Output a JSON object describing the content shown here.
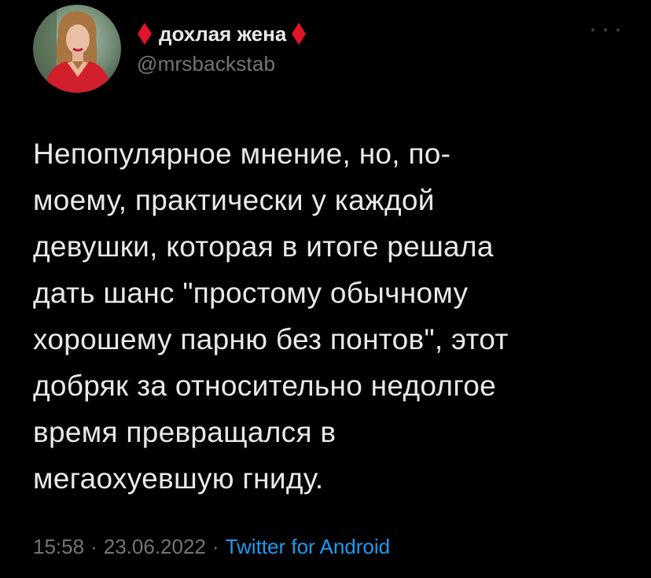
{
  "author": {
    "display_name": "дохлая жена",
    "handle": "@mrsbackstab",
    "avatar_icon": "profile-photo"
  },
  "header": {
    "more_icon": "ellipsis-icon"
  },
  "tweet": {
    "text": "Непопулярное мнение, но, по-\nмоему, практически у каждой\nдевушки, которая в итоге решала\nдать шанс \"простому обычному\nхорошему парню без понтов\", этот\nдобряк за относительно недолгое\nвремя превращался в\nмегаохуевшую гниду."
  },
  "meta": {
    "time": "15:58",
    "separator": "·",
    "date": "23.06.2022",
    "source": "Twitter for Android"
  },
  "colors": {
    "background": "#000000",
    "text": "#e7e9ea",
    "secondary": "#71767b",
    "link": "#1d9bf0",
    "diamond": "#e0142a"
  }
}
